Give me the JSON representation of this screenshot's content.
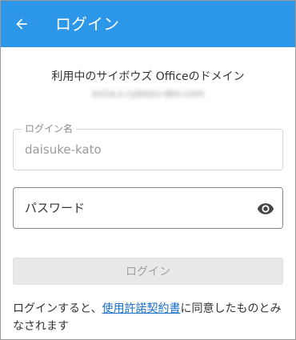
{
  "appbar": {
    "title": "ログイン",
    "back_icon": "arrow-left-icon"
  },
  "domain": {
    "label": "利用中のサイボウズ Officeのドメイン",
    "value": "xx1a.s.cybozu-dev.com"
  },
  "username_field": {
    "label": "ログイン名",
    "value": "daisuke-kato"
  },
  "password_field": {
    "placeholder": "パスワード",
    "value": "",
    "visibility_icon": "eye-icon"
  },
  "login_button": {
    "label": "ログイン"
  },
  "terms": {
    "prefix": "ログインすると、",
    "link": "使用許諾契約書",
    "suffix": "に同意したものとみなされます"
  },
  "colors": {
    "appbar": "#2c97e8",
    "link": "#1a6fc7",
    "disabled_button": "#e8e8e8"
  }
}
